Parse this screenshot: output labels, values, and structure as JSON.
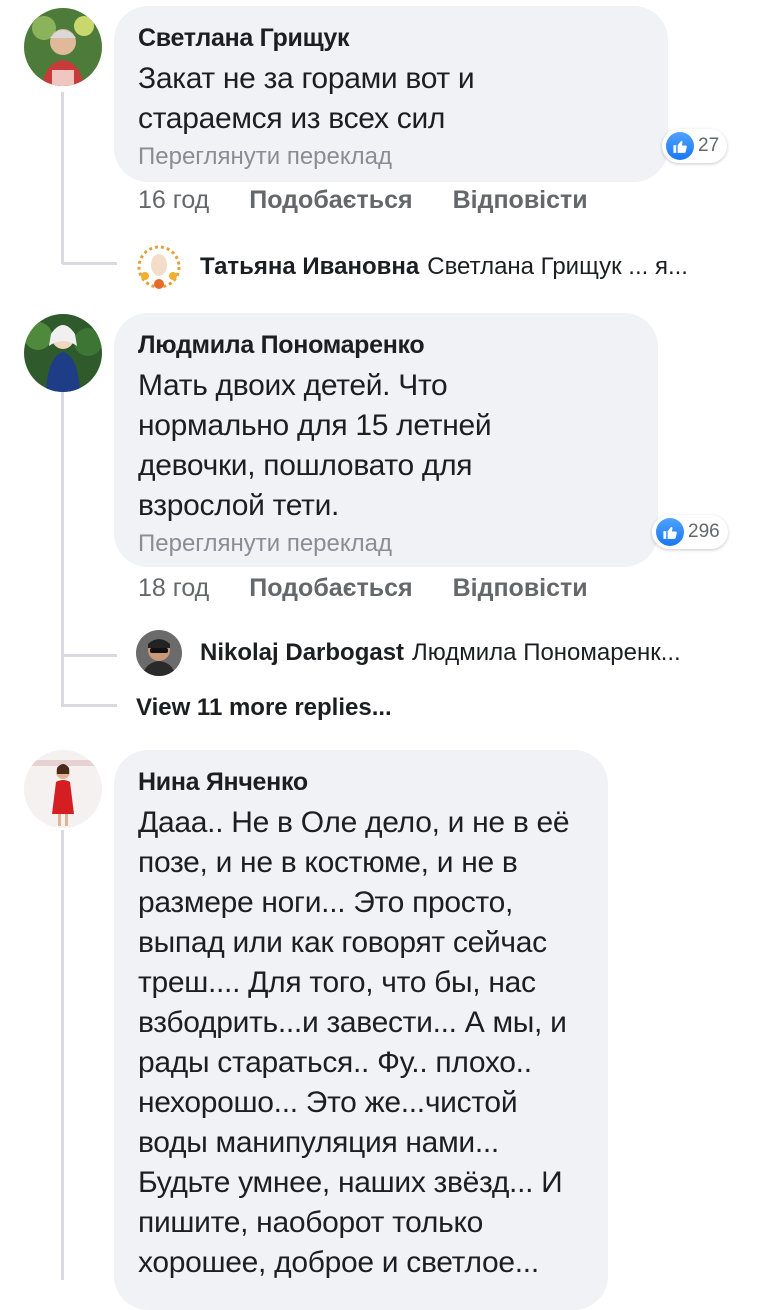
{
  "comments": [
    {
      "author": "Светлана Грищук",
      "text": "Закат не за горами вот и стараемся из всех сил",
      "translate": "Переглянути переклад",
      "reactions": "27",
      "time": "16 год",
      "like": "Подобається",
      "reply": "Відповісти",
      "reply_preview": {
        "author": "Татьяна Ивановна",
        "text": "Светлана Грищук ... я..."
      }
    },
    {
      "author": "Людмила Пономаренко",
      "text": "Мать двоих детей. Что нормально для 15 летней девочки,  пошловато  для взрослой тети.",
      "translate": "Переглянути переклад",
      "reactions": "296",
      "time": "18 год",
      "like": "Подобається",
      "reply": "Відповісти",
      "reply_preview": {
        "author": "Nikolaj Darbogast",
        "text": "Людмила Пономаренк..."
      },
      "more_replies": "View 11 more replies..."
    },
    {
      "author": "Нина Янченко",
      "text": "Дааа.. Не в Оле дело, и не в её позе, и не в костюме, и не в размере ноги... Это просто, выпад или как говорят сейчас треш.... Для того, что бы, нас взбодрить...и завести... А мы, и рады стараться.. Фу.. плохо.. нехорошо... Это же...чистой воды манипуляция нами... Будьте умнее, наших звёзд... И пишите, наоборот только хорошее, доброе и светлое..."
    }
  ],
  "colors": {
    "bubble": "#f0f2f5",
    "secondary_text": "#65676b",
    "like_blue": "#1877f2"
  },
  "icons": [
    "like-icon"
  ]
}
